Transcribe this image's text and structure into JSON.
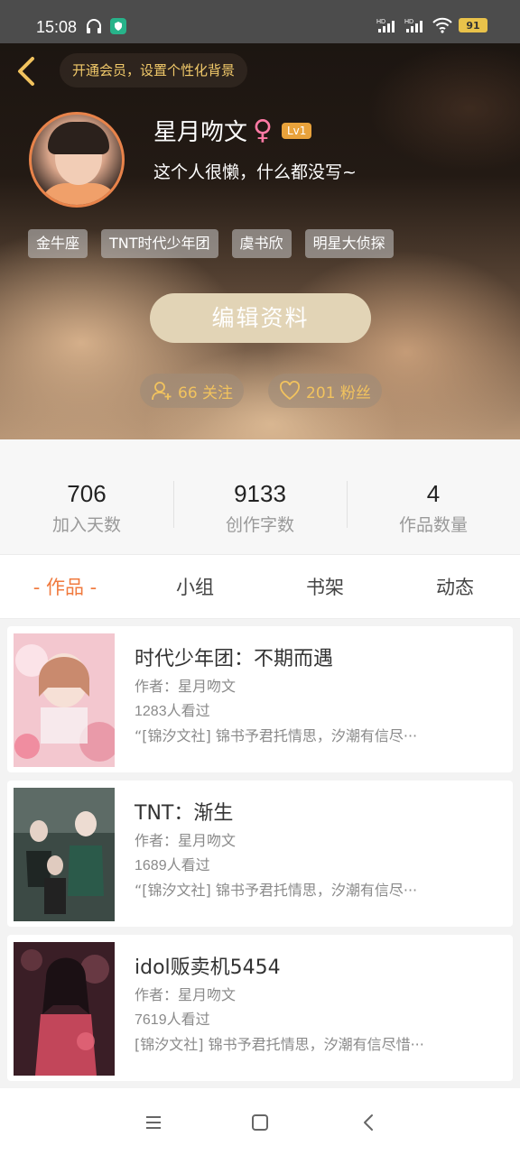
{
  "status_bar": {
    "time": "15:08",
    "battery": "91",
    "signal_1": "HD",
    "signal_2": "HD"
  },
  "header": {
    "vip_prompt": "开通会员，设置个性化背景",
    "username": "星月吻文",
    "gender_symbol": "♀",
    "level": "Lv1",
    "bio": "这个人很懒，什么都没写~",
    "tags": [
      "金牛座",
      "TNT时代少年团",
      "虞书欣",
      "明星大侦探"
    ],
    "edit_button": "编辑资料",
    "following": "66 关注",
    "fans": "201 粉丝"
  },
  "stats": [
    {
      "value": "706",
      "label": "加入天数"
    },
    {
      "value": "9133",
      "label": "创作字数"
    },
    {
      "value": "4",
      "label": "作品数量"
    }
  ],
  "tabs": [
    {
      "label": "- 作品 -",
      "active": true
    },
    {
      "label": "小组",
      "active": false
    },
    {
      "label": "书架",
      "active": false
    },
    {
      "label": "动态",
      "active": false
    }
  ],
  "works": [
    {
      "title": "时代少年团：不期而遇",
      "author": "作者：星月吻文",
      "views": "1283人看过",
      "desc": "“[锦汐文社] 锦书予君托情思，汐潮有信尽···",
      "cover_color": "#f3c7cf"
    },
    {
      "title": "TNT：渐生",
      "author": "作者：星月吻文",
      "views": "1689人看过",
      "desc": "“[锦汐文社] 锦书予君托情思，汐潮有信尽···",
      "cover_color": "#3c4a45"
    },
    {
      "title": "idol贩卖机5454",
      "author": "作者：星月吻文",
      "views": "7619人看过",
      "desc": "[锦汐文社] 锦书予君托情思，汐潮有信尽惜···",
      "cover_color": "#3a1e26"
    }
  ],
  "icons": {
    "back": "chevron-left-icon",
    "menu": "menu-icon",
    "home": "home-square-icon",
    "nav_back": "nav-back-icon"
  },
  "colors": {
    "accent_orange": "#f07a3e",
    "gold_text": "#f2c35e",
    "level_badge": "#e9a23b"
  }
}
